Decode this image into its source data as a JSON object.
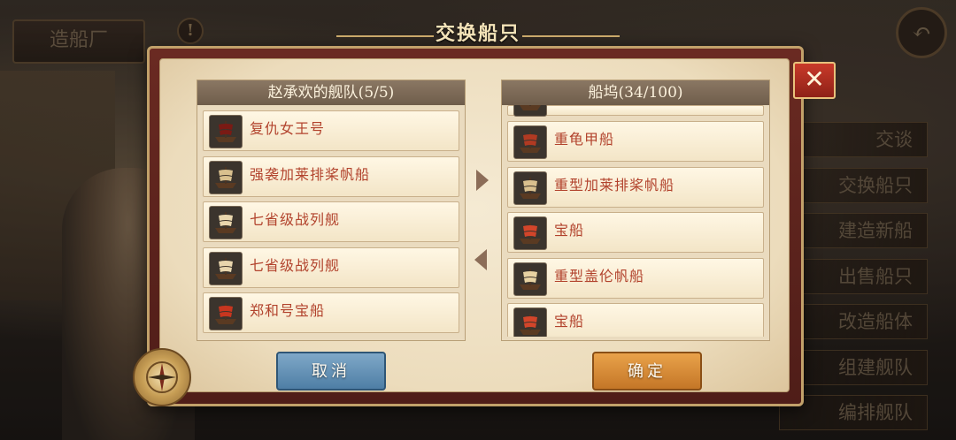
{
  "background": {
    "shipyard_label": "造船厂",
    "alert_glyph": "!",
    "back_glyph": "↶",
    "side_menu": [
      "交谈",
      "交换船只",
      "建造新船",
      "出售船只",
      "改造船体",
      "组建舰队",
      "编排舰队"
    ]
  },
  "dialog": {
    "title": "交换船只",
    "close_glyph": "✕",
    "left_panel": {
      "header": "赵承欢的舰队(5/5)",
      "ships": [
        {
          "name": "复仇女王号",
          "icon": "dark-galleon-icon",
          "color": "#7a1a14"
        },
        {
          "name": "强袭加莱排桨帆船",
          "icon": "galley-icon",
          "color": "#d9c08e"
        },
        {
          "name": "七省级战列舰",
          "icon": "ship-of-line-icon",
          "color": "#e9d6ad"
        },
        {
          "name": "七省级战列舰",
          "icon": "ship-of-line-icon",
          "color": "#e9d6ad"
        },
        {
          "name": "郑和号宝船",
          "icon": "treasure-ship-icon",
          "color": "#c8361f"
        }
      ]
    },
    "right_panel": {
      "header": "船坞(34/100)",
      "ships": [
        {
          "name": "",
          "icon": "partial-ship-icon",
          "color": "#6e5f4b",
          "partial": true
        },
        {
          "name": "重龟甲船",
          "icon": "turtle-ship-icon",
          "color": "#b03a22"
        },
        {
          "name": "重型加莱排桨帆船",
          "icon": "galley-icon",
          "color": "#d9c08e"
        },
        {
          "name": "宝船",
          "icon": "treasure-ship-icon",
          "color": "#d2452a"
        },
        {
          "name": "重型盖伦帆船",
          "icon": "galleon-icon",
          "color": "#e7d2a2"
        },
        {
          "name": "宝船",
          "icon": "treasure-ship-icon",
          "color": "#d2452a"
        }
      ]
    },
    "cancel_label": "取消",
    "confirm_label": "确定"
  }
}
